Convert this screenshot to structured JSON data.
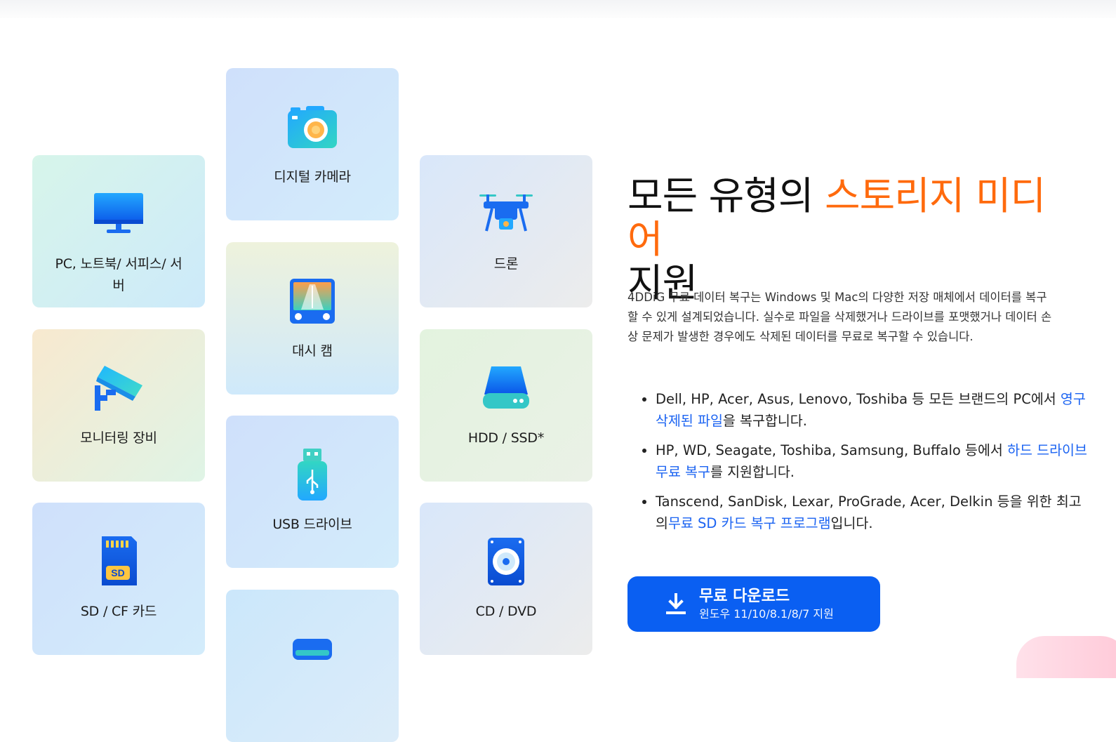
{
  "cards": {
    "pc": {
      "label": "PC, 노트북/ 서피스/ 서버"
    },
    "camera": {
      "label": "디지털 카메라"
    },
    "drone": {
      "label": "드론"
    },
    "dashcam": {
      "label": "대시 캠"
    },
    "monitoring": {
      "label": "모니터링 장비"
    },
    "hdd": {
      "label": "HDD / SSD*"
    },
    "usb": {
      "label": "USB 드라이브"
    },
    "sd": {
      "label": "SD / CF 카드"
    },
    "cd": {
      "label": "CD / DVD"
    }
  },
  "title": {
    "prefix": "모든 유형의 ",
    "accent": "스토리지 미디어",
    "suffix": "지원"
  },
  "description": "4DDiG 무료 데이터 복구는 Windows 및 Mac의 다양한 저장 매체에서 데이터를 복구할 수 있게 설계되었습니다. 실수로 파일을 삭제했거나 드라이브를 포맷했거나 데이터 손상 문제가 발생한 경우에도 삭제된 데이터를 무료로 복구할 수 있습니다.",
  "bullets": [
    {
      "before": "Dell, HP, Acer, Asus, Lenovo, Toshiba 등 모든 브랜드의 PC에서 ",
      "link": "영구 삭제된 파일",
      "after": "을 복구합니다."
    },
    {
      "before": "HP, WD, Seagate, Toshiba, Samsung, Buffalo 등에서 ",
      "link": "하드 드라이브 무료 복구",
      "after": "를 지원합니다."
    },
    {
      "before": "Tanscend, SanDisk, Lexar, ProGrade, Acer, Delkin 등을 위한 최고의",
      "link": "무료 SD 카드 복구 프로그램",
      "after": "입니다."
    }
  ],
  "download": {
    "label": "무료 다운로드",
    "sublabel": "윈도우 11/10/8.1/8/7 지원"
  },
  "colors": {
    "accent": "#ff6a0d",
    "link": "#1c64f2",
    "button": "#0a5ff2"
  }
}
